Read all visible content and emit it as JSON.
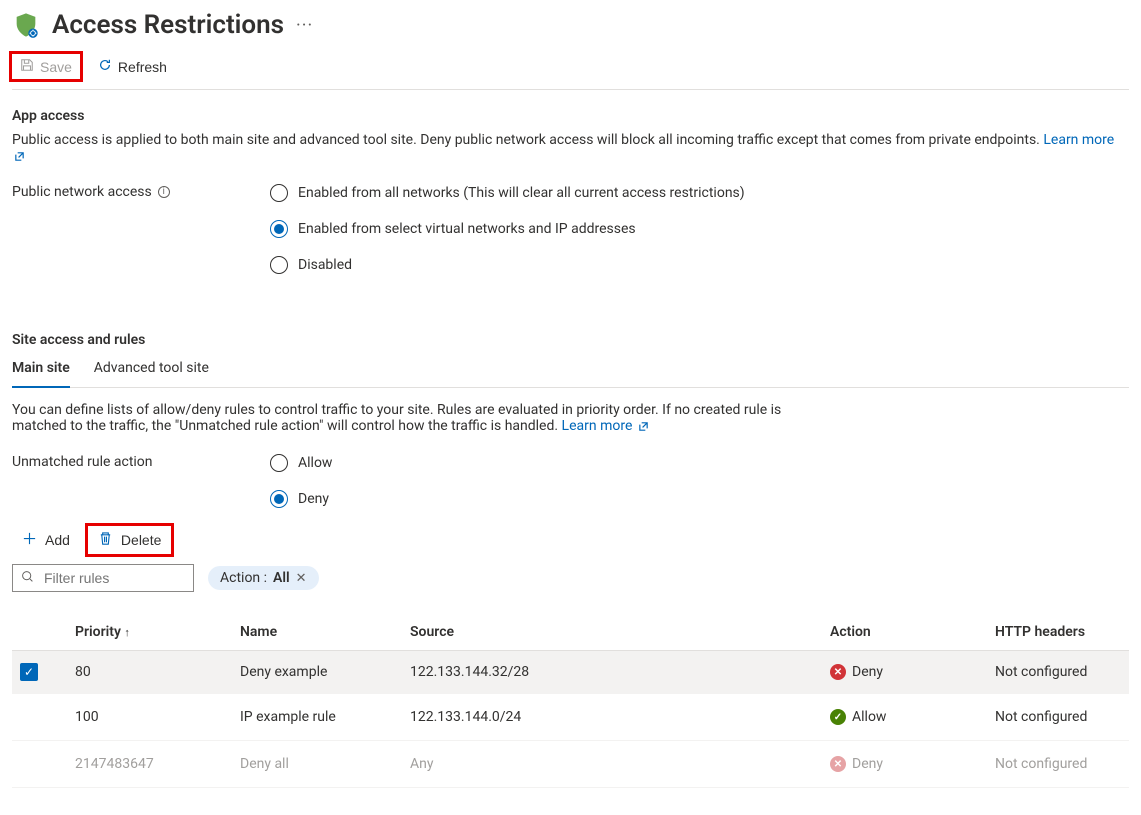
{
  "header": {
    "title": "Access Restrictions"
  },
  "toolbar": {
    "save_label": "Save",
    "refresh_label": "Refresh"
  },
  "app_access": {
    "heading": "App access",
    "desc": "Public access is applied to both main site and advanced tool site. Deny public network access will block all incoming traffic except that comes from private endpoints.",
    "learn_more": "Learn more",
    "pna_label": "Public network access",
    "options": {
      "enabled_all": "Enabled from all networks (This will clear all current access restrictions)",
      "enabled_select": "Enabled from select virtual networks and IP addresses",
      "disabled": "Disabled"
    },
    "selected": "enabled_select"
  },
  "site_access": {
    "heading": "Site access and rules",
    "tabs": {
      "main": "Main site",
      "advanced": "Advanced tool site"
    },
    "desc": "You can define lists of allow/deny rules to control traffic to your site. Rules are evaluated in priority order. If no created rule is matched to the traffic, the \"Unmatched rule action\" will control how the traffic is handled.",
    "learn_more": "Learn more",
    "unmatched_label": "Unmatched rule action",
    "unmatched_options": {
      "allow": "Allow",
      "deny": "Deny"
    },
    "unmatched_selected": "deny"
  },
  "rules_toolbar": {
    "add_label": "Add",
    "delete_label": "Delete"
  },
  "filter": {
    "placeholder": "Filter rules",
    "pill_prefix": "Action : ",
    "pill_value": "All"
  },
  "columns": {
    "priority": "Priority",
    "name": "Name",
    "source": "Source",
    "action": "Action",
    "http_headers": "HTTP headers"
  },
  "rules": [
    {
      "selected": true,
      "priority": "80",
      "name": "Deny example",
      "source": "122.133.144.32/28",
      "action": "Deny",
      "http_headers": "Not configured",
      "dim": false
    },
    {
      "selected": false,
      "priority": "100",
      "name": "IP example rule",
      "source": "122.133.144.0/24",
      "action": "Allow",
      "http_headers": "Not configured",
      "dim": false
    },
    {
      "selected": false,
      "priority": "2147483647",
      "name": "Deny all",
      "source": "Any",
      "action": "Deny",
      "http_headers": "Not configured",
      "dim": true
    }
  ]
}
